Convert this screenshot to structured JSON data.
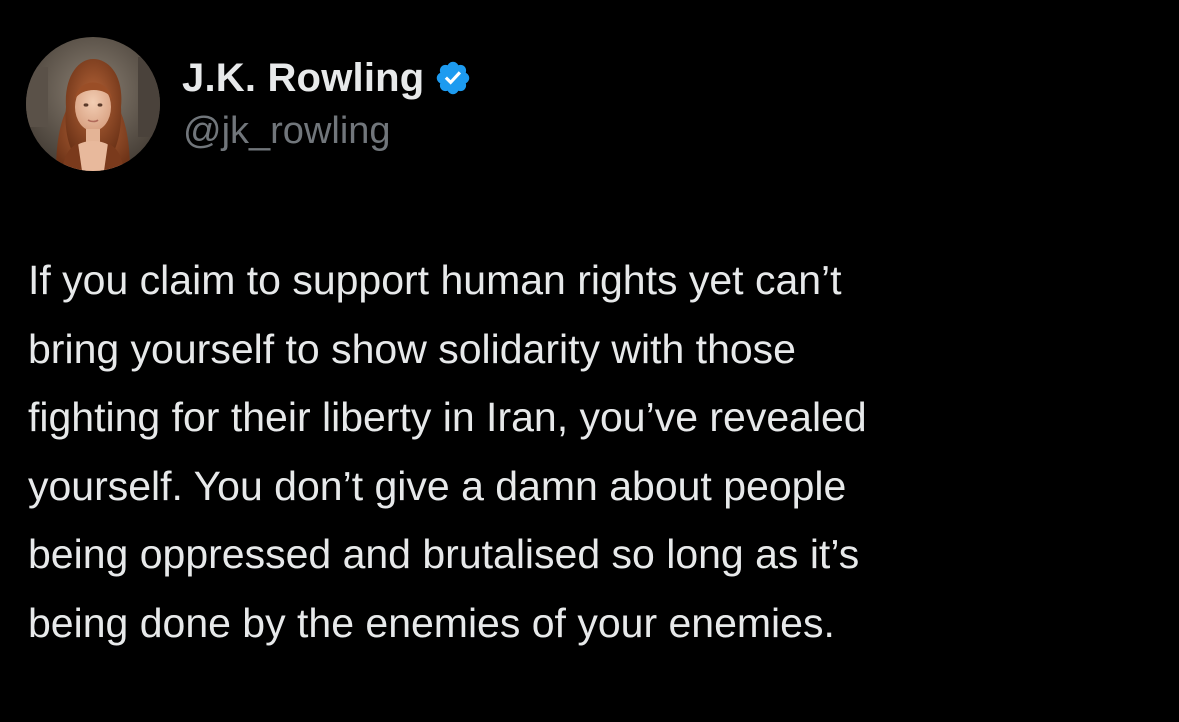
{
  "author": {
    "display_name": "J.K. Rowling",
    "handle": "@jk_rowling",
    "verified": true,
    "avatar_icon": "profile-photo"
  },
  "tweet": {
    "text": "If you claim to support human rights yet can’t\nbring yourself to show solidarity with those\nfighting for their liberty in Iran, you’ve revealed\nyourself. You don’t give a damn about people\nbeing oppressed and brutalised so long as it’s\nbeing done by the enemies of your enemies."
  },
  "colors": {
    "background": "#000000",
    "primary_text": "#e7e9ea",
    "secondary_text": "#71767b",
    "verified_badge": "#1d9bf0"
  }
}
